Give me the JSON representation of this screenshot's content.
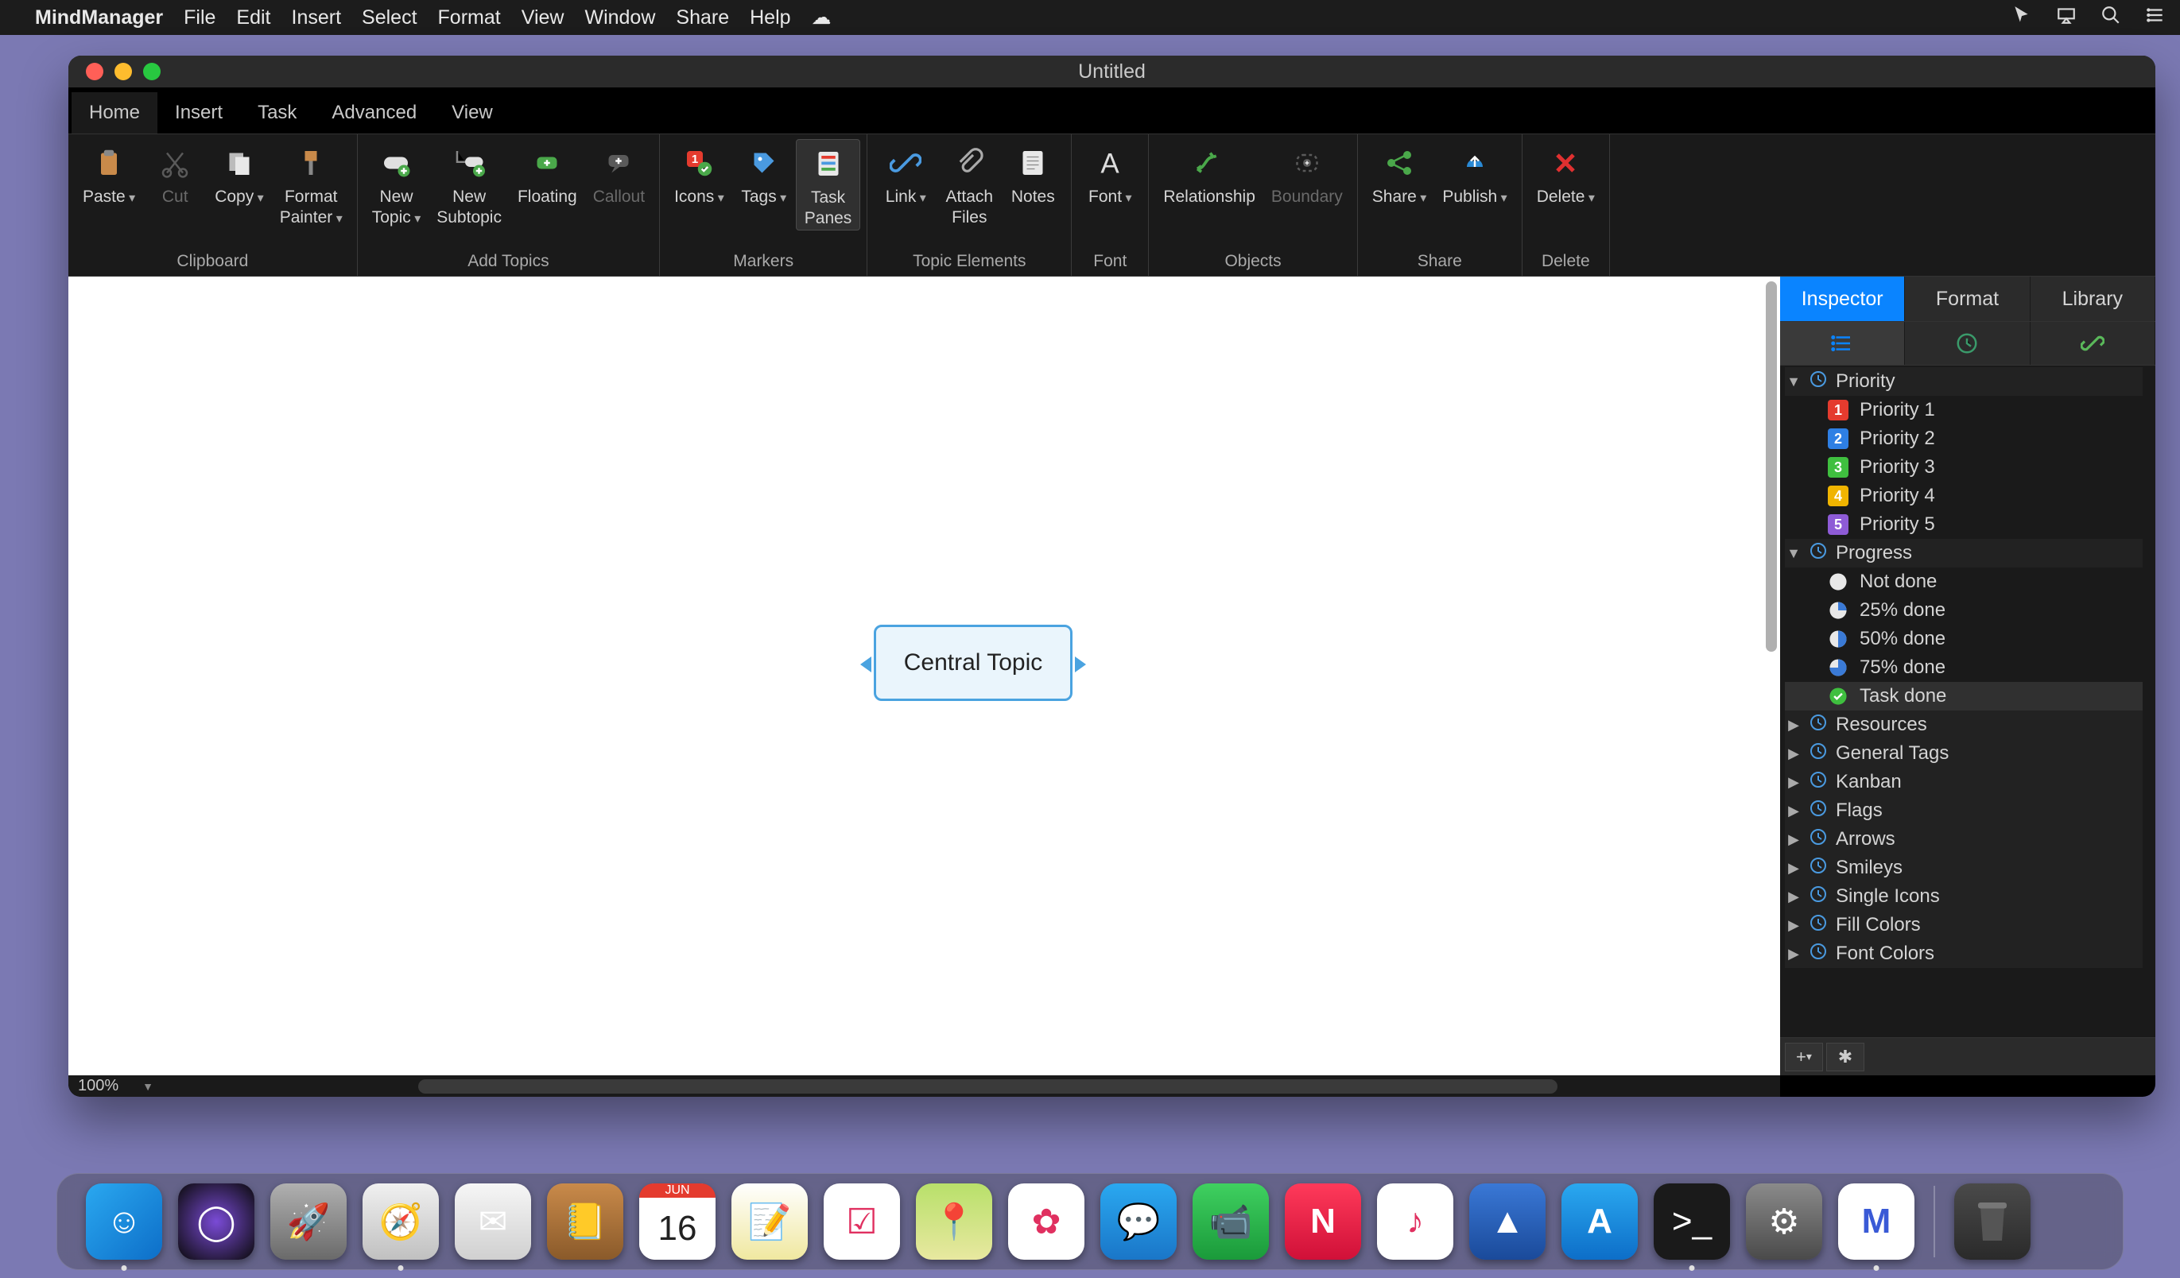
{
  "menubar": {
    "app": "MindManager",
    "items": [
      "File",
      "Edit",
      "Insert",
      "Select",
      "Format",
      "View",
      "Window",
      "Share",
      "Help"
    ]
  },
  "window": {
    "title": "Untitled"
  },
  "ribbon_tabs": [
    "Home",
    "Insert",
    "Task",
    "Advanced",
    "View"
  ],
  "ribbon_active_tab": "Home",
  "ribbon_groups": [
    {
      "name": "Clipboard",
      "buttons": [
        {
          "id": "paste",
          "label": "Paste",
          "drop": true
        },
        {
          "id": "cut",
          "label": "Cut",
          "disabled": true
        },
        {
          "id": "copy",
          "label": "Copy",
          "drop": true
        },
        {
          "id": "format-painter",
          "label": "Format\nPainter",
          "drop": true
        }
      ]
    },
    {
      "name": "Add Topics",
      "buttons": [
        {
          "id": "new-topic",
          "label": "New\nTopic",
          "drop": true
        },
        {
          "id": "new-subtopic",
          "label": "New\nSubtopic"
        },
        {
          "id": "floating",
          "label": "Floating"
        },
        {
          "id": "callout",
          "label": "Callout",
          "disabled": true
        }
      ]
    },
    {
      "name": "Markers",
      "buttons": [
        {
          "id": "icons",
          "label": "Icons",
          "drop": true
        },
        {
          "id": "tags",
          "label": "Tags",
          "drop": true
        },
        {
          "id": "task-panes",
          "label": "Task\nPanes",
          "selected": true
        }
      ]
    },
    {
      "name": "Topic Elements",
      "buttons": [
        {
          "id": "link",
          "label": "Link",
          "drop": true
        },
        {
          "id": "attach-files",
          "label": "Attach\nFiles"
        },
        {
          "id": "notes",
          "label": "Notes"
        }
      ]
    },
    {
      "name": "Font",
      "buttons": [
        {
          "id": "font",
          "label": "Font",
          "drop": true
        }
      ]
    },
    {
      "name": "Objects",
      "buttons": [
        {
          "id": "relationship",
          "label": "Relationship"
        },
        {
          "id": "boundary",
          "label": "Boundary",
          "disabled": true
        }
      ]
    },
    {
      "name": "Share",
      "buttons": [
        {
          "id": "share",
          "label": "Share",
          "drop": true
        },
        {
          "id": "publish",
          "label": "Publish",
          "drop": true
        }
      ]
    },
    {
      "name": "Delete",
      "buttons": [
        {
          "id": "delete",
          "label": "Delete",
          "drop": true
        }
      ]
    }
  ],
  "canvas": {
    "central_topic": "Central Topic"
  },
  "zoom": "100%",
  "inspector": {
    "tabs": [
      "Inspector",
      "Format",
      "Library"
    ],
    "active_tab": "Inspector",
    "categories": [
      {
        "id": "priority",
        "label": "Priority",
        "expanded": true,
        "items": [
          {
            "label": "Priority 1",
            "color": "#e43b2e",
            "num": "1"
          },
          {
            "label": "Priority 2",
            "color": "#2e7fe4",
            "num": "2"
          },
          {
            "label": "Priority 3",
            "color": "#3fbf3f",
            "num": "3"
          },
          {
            "label": "Priority 4",
            "color": "#f0b400",
            "num": "4"
          },
          {
            "label": "Priority 5",
            "color": "#8e5bd6",
            "num": "5"
          }
        ]
      },
      {
        "id": "progress",
        "label": "Progress",
        "expanded": true,
        "items": [
          {
            "label": "Not done",
            "pct": 0
          },
          {
            "label": "25% done",
            "pct": 25
          },
          {
            "label": "50% done",
            "pct": 50
          },
          {
            "label": "75% done",
            "pct": 75
          },
          {
            "label": "Task done",
            "pct": 100,
            "selected": true
          }
        ]
      },
      {
        "id": "resources",
        "label": "Resources",
        "expanded": false
      },
      {
        "id": "general-tags",
        "label": "General Tags",
        "expanded": false
      },
      {
        "id": "kanban",
        "label": "Kanban",
        "expanded": false
      },
      {
        "id": "flags",
        "label": "Flags",
        "expanded": false
      },
      {
        "id": "arrows",
        "label": "Arrows",
        "expanded": false
      },
      {
        "id": "smileys",
        "label": "Smileys",
        "expanded": false
      },
      {
        "id": "single-icons",
        "label": "Single Icons",
        "expanded": false
      },
      {
        "id": "fill-colors",
        "label": "Fill Colors",
        "expanded": false
      },
      {
        "id": "font-colors",
        "label": "Font Colors",
        "expanded": false
      }
    ]
  },
  "dock": [
    {
      "id": "finder",
      "bg": "linear-gradient(135deg,#2aa8f0,#0d6ec8)",
      "glyph": "☺",
      "indic": true
    },
    {
      "id": "siri",
      "bg": "radial-gradient(circle,#7a4bd6,#0a0a0a)",
      "glyph": "◯"
    },
    {
      "id": "launchpad",
      "bg": "linear-gradient(#b0b0b0,#6a6a6a)",
      "glyph": "🚀"
    },
    {
      "id": "safari",
      "bg": "linear-gradient(#f0f0f0,#c0c0c0)",
      "glyph": "🧭",
      "indic": true
    },
    {
      "id": "mail",
      "bg": "linear-gradient(#f6f6f6,#d0d0d0)",
      "glyph": "✉"
    },
    {
      "id": "contacts",
      "bg": "linear-gradient(#c98a4a,#8a5a2a)",
      "glyph": "📒"
    },
    {
      "id": "calendar",
      "bg": "#fff",
      "glyph": "16"
    },
    {
      "id": "notes",
      "bg": "linear-gradient(#fff,#f0e8a0)",
      "glyph": "📝"
    },
    {
      "id": "reminders",
      "bg": "#fff",
      "glyph": "☑"
    },
    {
      "id": "maps",
      "bg": "linear-gradient(#b8e06a,#e8e8a0)",
      "glyph": "📍"
    },
    {
      "id": "photos",
      "bg": "#fff",
      "glyph": "✿"
    },
    {
      "id": "messages",
      "bg": "linear-gradient(#2aa8f0,#1a76c8)",
      "glyph": "💬"
    },
    {
      "id": "facetime",
      "bg": "linear-gradient(#3fd060,#1a9a3a)",
      "glyph": "📹"
    },
    {
      "id": "news",
      "bg": "linear-gradient(#ff3a5a,#d01038)",
      "glyph": "N"
    },
    {
      "id": "itunes",
      "bg": "#fff",
      "glyph": "♪"
    },
    {
      "id": "mountains",
      "bg": "linear-gradient(#3a78d6,#1a4a9a)",
      "glyph": "▲"
    },
    {
      "id": "appstore",
      "bg": "linear-gradient(#2aa8f0,#0d6ec8)",
      "glyph": "A"
    },
    {
      "id": "terminal",
      "bg": "#1a1a1a",
      "glyph": ">_",
      "indic": true
    },
    {
      "id": "settings",
      "bg": "linear-gradient(#8a8a8a,#4a4a4a)",
      "glyph": "⚙"
    },
    {
      "id": "mindmanager",
      "bg": "#fff",
      "glyph": "M",
      "indic": true
    }
  ]
}
